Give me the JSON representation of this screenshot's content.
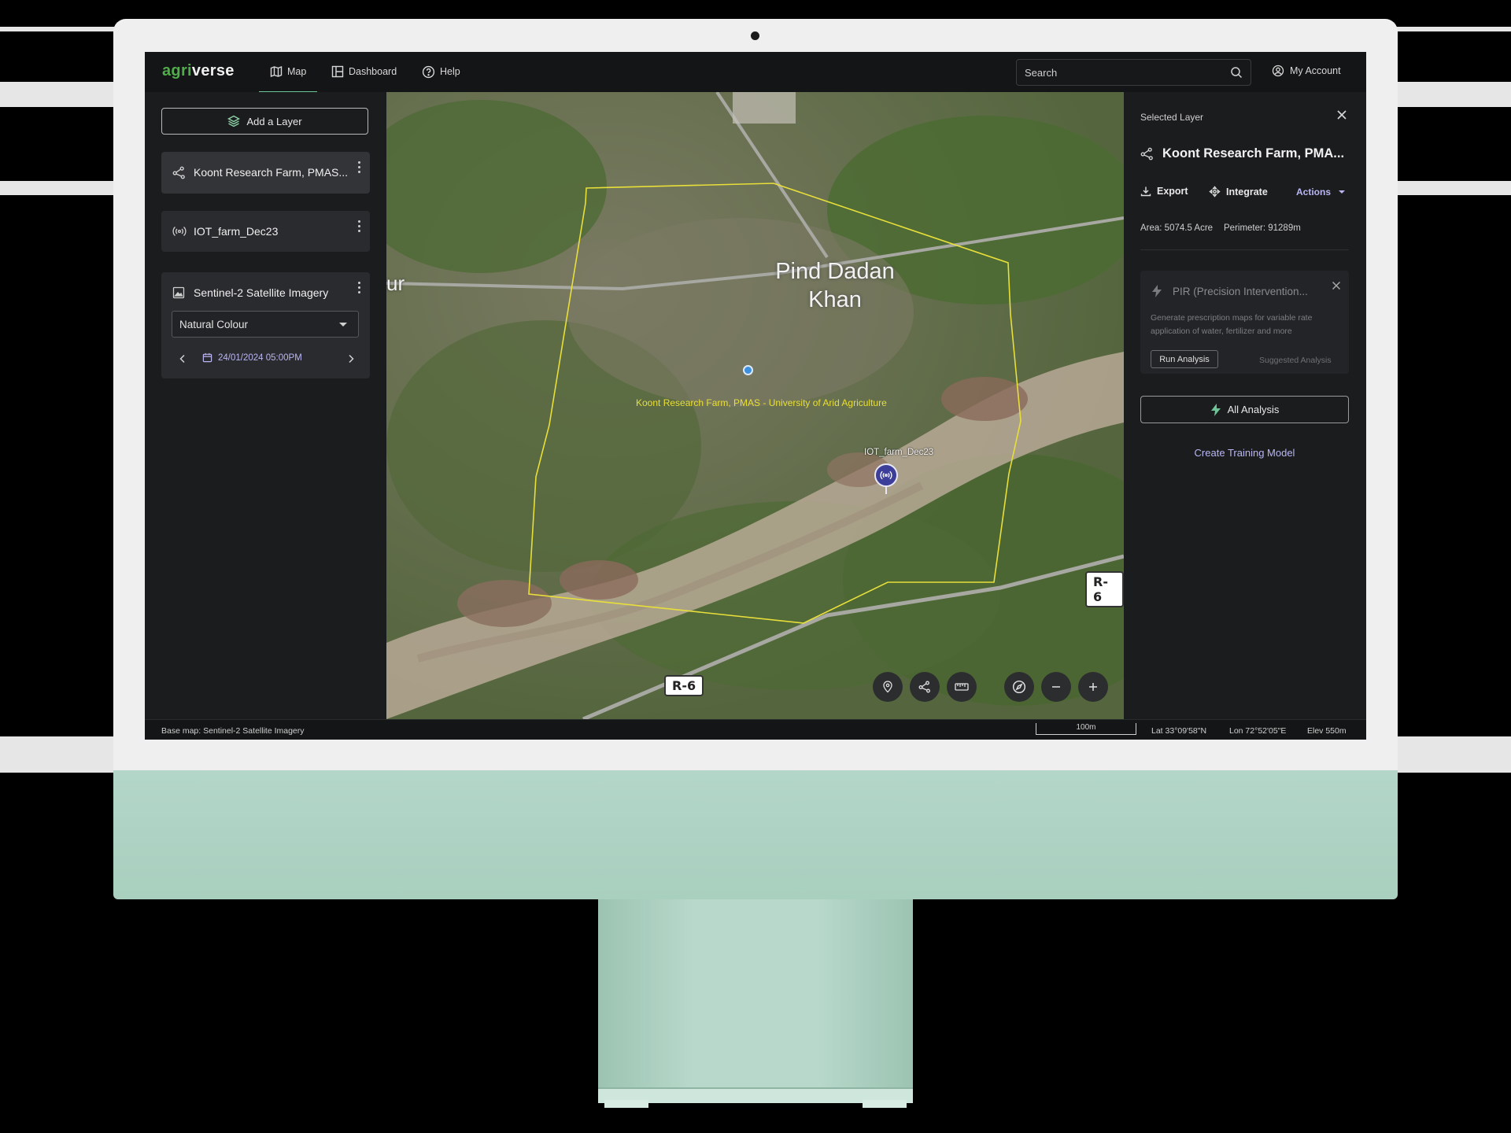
{
  "app": {
    "logo_part1": "agri",
    "logo_part2": "verse",
    "nav": [
      {
        "label": "Map",
        "active": true
      },
      {
        "label": "Dashboard",
        "active": false
      },
      {
        "label": "Help",
        "active": false
      }
    ],
    "search": {
      "placeholder": "Search"
    },
    "account_label": "My Account"
  },
  "left_panel": {
    "add_layer_label": "Add a Layer",
    "layers": [
      {
        "name": "Koont Research Farm, PMAS...",
        "icon": "polygon-share-icon",
        "selected": true
      },
      {
        "name": "IOT_farm_Dec23",
        "icon": "broadcast-icon",
        "selected": false
      },
      {
        "name": "Sentinel-2 Satellite Imagery",
        "icon": "image-icon",
        "selected": false
      }
    ],
    "imagery": {
      "band_select_value": "Natural Colour",
      "date": "24/01/2024 05:00PM"
    }
  },
  "map": {
    "place_name_line1": "Pind Dadan",
    "place_name_line2": "Khan",
    "place_name_edge": "ur",
    "farm_label": "Koont Research Farm, PMAS - University of Arid Agriculture",
    "iot_label": "IOT_farm_Dec23",
    "road_labels": [
      "R-6",
      "R-6"
    ],
    "colors": {
      "boundary": "#e8df3a",
      "marker": "#3d8fe0"
    }
  },
  "right_panel": {
    "header": "Selected Layer",
    "layer_name": "Koont Research Farm, PMA...",
    "actions": {
      "export": "Export",
      "integrate": "Integrate",
      "more": "Actions"
    },
    "area": "Area: 5074.5 Acre",
    "perimeter": "Perimeter: 91289m",
    "suggestion": {
      "title": "PIR (Precision Intervention...",
      "description_line1": "Generate prescription maps for variable rate",
      "description_line2": "application of water, fertilizer and more",
      "run_label": "Run Analysis",
      "tag": "Suggested Analysis"
    },
    "all_analysis_label": "All Analysis",
    "training_link": "Create Training Model",
    "accent_color": "#6fc398",
    "link_color": "#b9b6f2"
  },
  "status_bar": {
    "base_map": "Base map: Sentinel-2 Satellite Imagery",
    "scale": "100m",
    "lat": "Lat 33°09'58\"N",
    "lon": "Lon 72°52'05\"E",
    "elev": "Elev 550m"
  }
}
